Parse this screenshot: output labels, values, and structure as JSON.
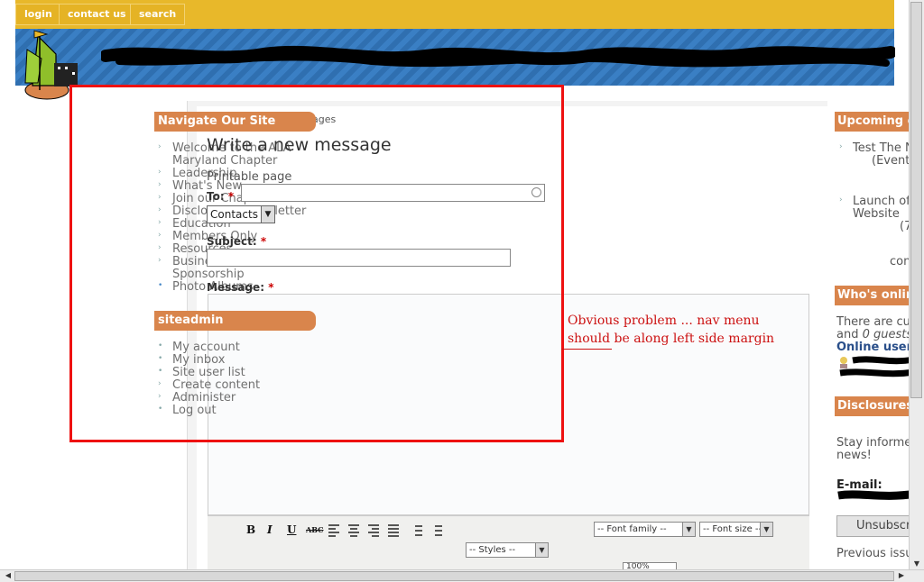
{
  "top_nav": [
    "login",
    "contact us",
    "search"
  ],
  "breadcrumb_tail": "ages",
  "left_nav": {
    "title": "Navigate Our Site",
    "items": [
      "Welcome to the ALA",
      "Maryland Chapter",
      "Leadership",
      "What's New",
      "Join our Chapter",
      "Disclosures Newsletter",
      "Education",
      "Members Only",
      "Resources",
      "Business Partners &",
      "Sponsorship",
      "Photo Albums"
    ]
  },
  "siteadmin": {
    "title": "siteadmin",
    "items": [
      "My account",
      "My inbox",
      "Site user list",
      "Create content",
      "Administer",
      "Log out"
    ]
  },
  "main": {
    "page_title": "Write a new message",
    "printable": "Printable page",
    "to_label": "To:",
    "contacts_value": "Contacts",
    "subject_label": "Subject:",
    "message_label": "Message:",
    "required_mark": "*"
  },
  "editor": {
    "buttons": [
      "B",
      "I",
      "U",
      "ABC"
    ],
    "font_family": "-- Font family --",
    "font_size": "-- Font size --",
    "styles": "-- Styles --",
    "zoom": "100%"
  },
  "right": {
    "upcoming_title": "Upcoming e",
    "upcoming_item1": "Test The N",
    "upcoming_item1b": "(Event",
    "upcoming_item2": "Launch of",
    "upcoming_item2b": "Website",
    "upcoming_item2c": "(7",
    "upcoming_item3": "con",
    "whos_title": "Who's onlin",
    "whos_line1": "There are cu",
    "whos_line2a": "and ",
    "whos_line2b": "0 guests",
    "whos_line3": "Online users",
    "disclosures_title": "Disclosures",
    "disc_line1": "Stay informe",
    "disc_line2": "news!",
    "email_label": "E-mail:",
    "unsub_button": "Unsubscri",
    "prev_issues": "Previous issu"
  },
  "annotation": "Obvious problem ... nav menu should be along left side margin",
  "colors": {
    "accent": "#d9854c",
    "topbar": "#e8b82a",
    "redbox": "#ee1111"
  }
}
